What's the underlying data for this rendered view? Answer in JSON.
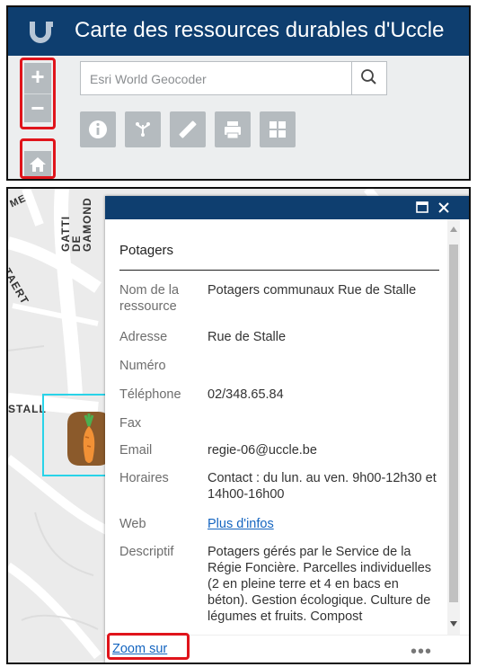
{
  "app": {
    "title": "Carte des ressources durables d'Uccle"
  },
  "search": {
    "placeholder": "Esri World Geocoder"
  },
  "map_labels": {
    "street_1": "GATTI DE GAMOND",
    "street_2": "STALL",
    "street_3": "TAERT",
    "street_4": "ME"
  },
  "icons": {
    "zoom_in": "plus-icon",
    "zoom_out": "minus-icon",
    "home": "home-icon",
    "search": "search-icon",
    "tools": [
      "info-icon",
      "share-icon",
      "measure-icon",
      "print-icon",
      "basemap-grid-icon"
    ],
    "popup": [
      "maximize-icon",
      "close-icon",
      "more-icon"
    ]
  },
  "colors": {
    "header": "#0e3e6f",
    "highlight": "#e0141b",
    "selection": "#29d3e8",
    "link": "#1565c0"
  },
  "popup": {
    "title": "Potagers",
    "fields": [
      {
        "label": "Nom de la ressource",
        "value": "Potagers communaux Rue de Stalle"
      },
      {
        "label": "Adresse",
        "value": "Rue de Stalle"
      },
      {
        "label": "Numéro",
        "value": ""
      },
      {
        "label": "Téléphone",
        "value": "02/348.65.84"
      },
      {
        "label": "Fax",
        "value": ""
      },
      {
        "label": "Email",
        "value": "regie-06@uccle.be"
      },
      {
        "label": "Horaires",
        "value": "Contact : du lun. au ven. 9h00-12h30 et 14h00-16h00"
      },
      {
        "label": "Web",
        "value": "Plus d'infos"
      },
      {
        "label": "Descriptif",
        "value": "Potagers gérés par le Service de la Régie Foncière. Parcelles individuelles (2 en pleine terre et 4 en bacs en béton). Gestion écologique. Culture de légumes et fruits. Compost"
      }
    ],
    "zoom_link": "Zoom sur",
    "more": "•••"
  }
}
